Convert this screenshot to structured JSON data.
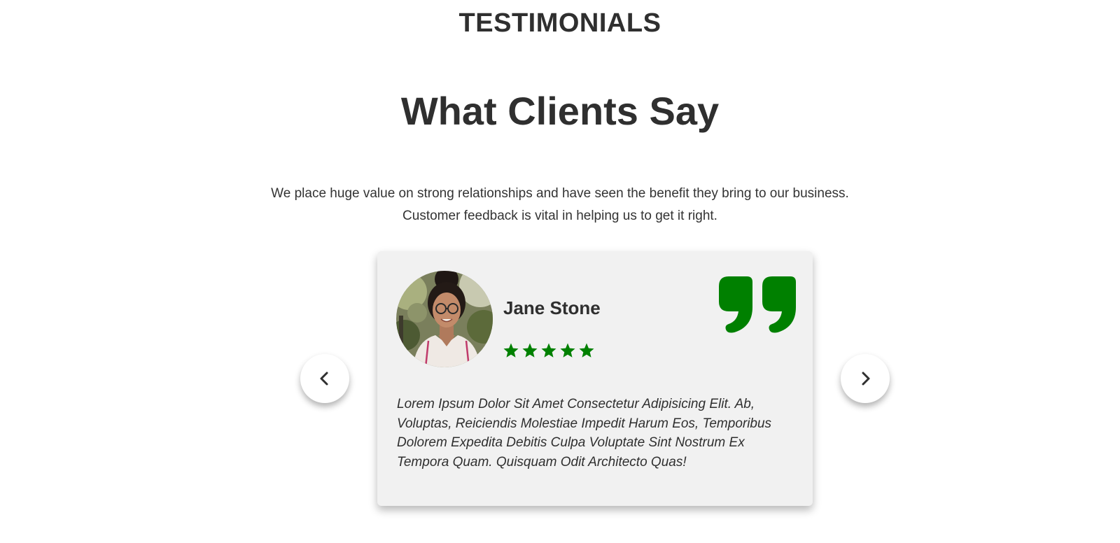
{
  "section": {
    "eyebrow": "TESTIMONIALS",
    "headline": "What Clients Say",
    "subtitle_lines": [
      "We place huge value on strong relationships and have seen the benefit they bring to our business.",
      "Customer feedback is vital in helping us to get it right."
    ]
  },
  "testimonial": {
    "name": "Jane Stone",
    "rating": 5,
    "rating_max": 5,
    "text": "Lorem Ipsum Dolor Sit Amet Consectetur Adipisicing Elit. Ab, Voluptas, Reiciendis Molestiae Impedit Harum Eos, Temporibus Dolorem Expedita Debitis Culpa Voluptate Sint Nostrum Ex Tempora Quam. Quisquam Odit Architecto Quas!",
    "avatar_icon": "person-photo",
    "quote_icon": "quote-icon"
  },
  "navigation": {
    "prev_icon": "chevron-left-icon",
    "next_icon": "chevron-right-icon"
  },
  "colors": {
    "accent": "#008000",
    "text": "#2f2f2f",
    "card_bg": "#f1f1f1",
    "page_bg": "#ffffff"
  }
}
